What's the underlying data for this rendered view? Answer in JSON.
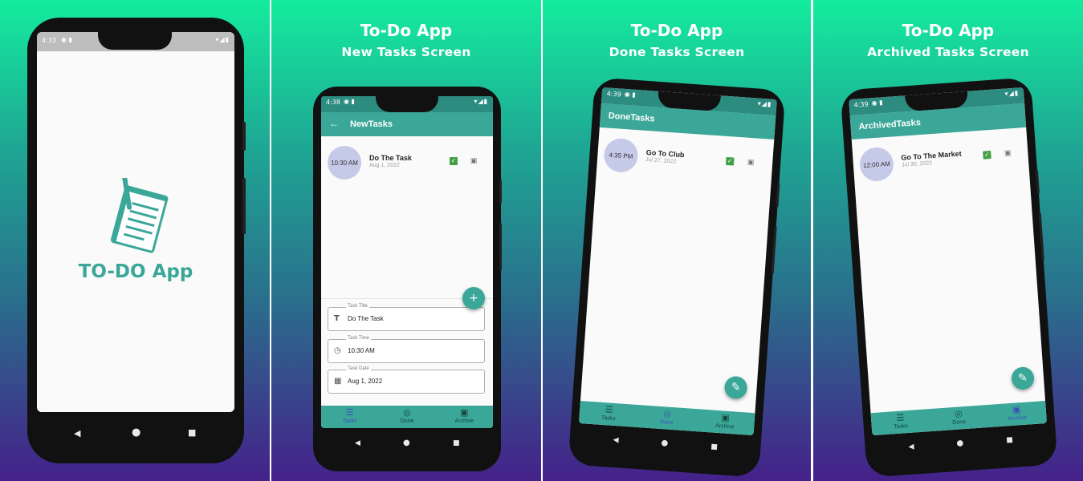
{
  "colors": {
    "accent": "#3aa798",
    "status_bar": "#2c8c80",
    "avatar": "#c5cae9",
    "check": "#43a047",
    "active_tab": "#3f51b5"
  },
  "splash": {
    "status_time": "4:33",
    "app_name": "TO-DO App",
    "logo_icon": "notebook-pencil-icon"
  },
  "panel_new": {
    "title": "To-Do App",
    "subtitle": "New Tasks Screen",
    "status_time": "4:38",
    "appbar_title": "NewTasks",
    "back_icon": "←",
    "task": {
      "time": "10:30 AM",
      "title": "Do The Task",
      "date": "Aug 1, 2022"
    },
    "form": {
      "title_label": "Task Title",
      "title_value": "Do The Task",
      "time_label": "Task Time",
      "time_value": "10:30 AM",
      "date_label": "Task Date",
      "date_value": "Aug 1, 2022"
    },
    "fab_icon": "+",
    "nav": [
      "Tasks",
      "Done",
      "Archive"
    ]
  },
  "panel_done": {
    "title": "To-Do App",
    "subtitle": "Done Tasks Screen",
    "status_time": "4:39",
    "appbar_title": "DoneTasks",
    "task": {
      "time": "4:35 PM",
      "title": "Go To Club",
      "date": "Jul 27, 2022"
    },
    "fab_icon": "✎",
    "nav": [
      "Tasks",
      "Done",
      "Archive"
    ]
  },
  "panel_archived": {
    "title": "To-Do App",
    "subtitle": "Archived Tasks Screen",
    "status_time": "4:39",
    "appbar_title": "ArchivedTasks",
    "task": {
      "time": "12:00 AM",
      "title": "Go To The Market",
      "date": "Jul 30, 2022"
    },
    "fab_icon": "✎",
    "nav": [
      "Tasks",
      "Done",
      "Archive"
    ]
  }
}
